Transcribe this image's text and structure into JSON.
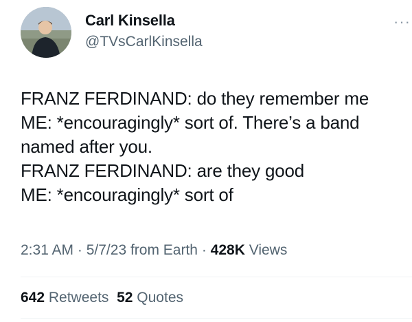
{
  "author": {
    "name": "Carl Kinsella",
    "handle": "@TVsCarlKinsella"
  },
  "more_menu": "···",
  "tweet": {
    "lines": [
      "FRANZ FERDINAND: do they remember me",
      "ME: *encouragingly* sort of. There’s a band",
      "named after you.",
      "FRANZ FERDINAND: are they good",
      "ME: *encouragingly* sort of"
    ]
  },
  "meta": {
    "time": "2:31 AM",
    "sep1": " · ",
    "date": "5/7/23",
    "source": " from Earth",
    "sep2": " · ",
    "views_count": "428K",
    "views_label": " Views"
  },
  "stats": {
    "retweets_count": "642",
    "retweets_label": " Retweets",
    "quotes_count": "52",
    "quotes_label": " Quotes"
  },
  "colors": {
    "text": "#0f1419",
    "secondary": "#536471",
    "divider": "#eff3f4"
  },
  "icons": {
    "more": "more-horizontal-icon"
  }
}
